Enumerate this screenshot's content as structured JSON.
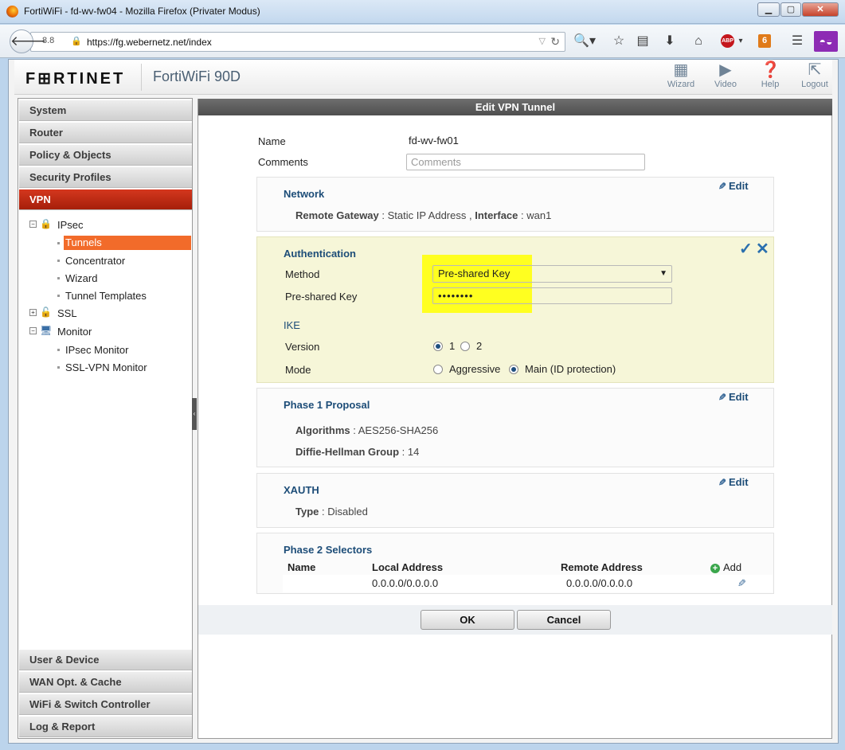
{
  "browser": {
    "title": "FortiWiFi - fd-wv-fw04 - Mozilla Firefox (Privater Modus)",
    "badge": "8.8",
    "url": "https://fg.webernetz.net/index",
    "abp": "ABP",
    "six": "6"
  },
  "app": {
    "logo": "F⊞RTINET",
    "model": "FortiWiFi 90D",
    "header_icons": [
      {
        "label": "Wizard",
        "icon": "wizard-icon"
      },
      {
        "label": "Video",
        "icon": "video-icon"
      },
      {
        "label": "Help",
        "icon": "help-icon"
      },
      {
        "label": "Logout",
        "icon": "logout-icon"
      }
    ]
  },
  "sidebar": {
    "top_menus": [
      "System",
      "Router",
      "Policy & Objects",
      "Security Profiles",
      "VPN"
    ],
    "tree": {
      "ipsec": "IPsec",
      "tunnels": "Tunnels",
      "concentrator": "Concentrator",
      "wizard": "Wizard",
      "tunnel_templates": "Tunnel Templates",
      "ssl": "SSL",
      "monitor": "Monitor",
      "ipsec_monitor": "IPsec Monitor",
      "sslvpn_monitor": "SSL-VPN Monitor"
    },
    "bottom_menus": [
      "User & Device",
      "WAN Opt. & Cache",
      "WiFi & Switch Controller",
      "Log & Report"
    ]
  },
  "content": {
    "title": "Edit VPN Tunnel",
    "name_label": "Name",
    "name_value": "fd-wv-fw01",
    "comments_label": "Comments",
    "comments_placeholder": "Comments",
    "edit_label": "Edit",
    "network": {
      "heading": "Network",
      "gw_key": "Remote Gateway",
      "gw_value": " : Static IP Address , ",
      "if_key": "Interface",
      "if_value": " : wan1"
    },
    "auth": {
      "heading": "Authentication",
      "method_label": "Method",
      "method_value": "Pre-shared Key",
      "psk_label": "Pre-shared Key",
      "psk_value": "••••••••",
      "ike_heading": "IKE",
      "version_label": "Version",
      "version_1": "1",
      "version_2": "2",
      "mode_label": "Mode",
      "mode_aggressive": "Aggressive",
      "mode_main": "Main (ID protection)"
    },
    "phase1": {
      "heading": "Phase 1 Proposal",
      "alg_key": "Algorithms",
      "alg_value": " : AES256-SHA256",
      "dh_key": "Diffie-Hellman Group",
      "dh_value": " : 14"
    },
    "xauth": {
      "heading": "XAUTH",
      "type_key": "Type",
      "type_value": " : Disabled"
    },
    "phase2": {
      "heading": "Phase 2 Selectors",
      "col_name": "Name",
      "col_local": "Local Address",
      "col_remote": "Remote Address",
      "add_label": "Add",
      "rows": [
        {
          "name": "",
          "local": "0.0.0.0/0.0.0.0",
          "remote": "0.0.0.0/0.0.0.0"
        }
      ]
    },
    "ok_label": "OK",
    "cancel_label": "Cancel"
  }
}
